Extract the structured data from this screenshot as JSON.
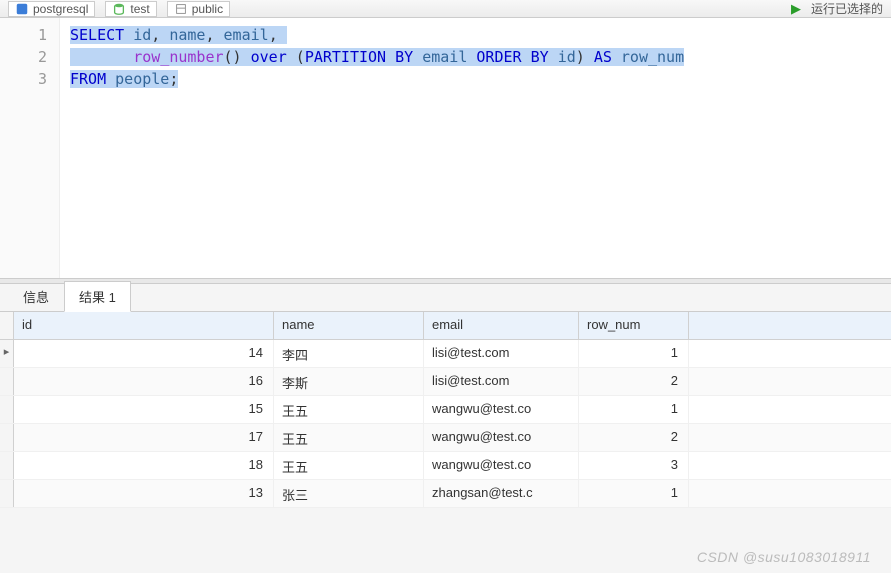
{
  "toolbar": {
    "connection_label": "postgresql",
    "database_label": "test",
    "schema_label": "public",
    "run_label": "运行已选择的"
  },
  "editor": {
    "lines": [
      "1",
      "2",
      "3"
    ],
    "code_tokens": [
      [
        {
          "t": "SELECT",
          "c": "kw",
          "hl": true
        },
        {
          "t": " ",
          "c": "plain",
          "hl": true
        },
        {
          "t": "id",
          "c": "ident",
          "hl": true
        },
        {
          "t": ", ",
          "c": "plain",
          "hl": true
        },
        {
          "t": "name",
          "c": "ident",
          "hl": true
        },
        {
          "t": ", ",
          "c": "plain",
          "hl": true
        },
        {
          "t": "email",
          "c": "ident",
          "hl": true
        },
        {
          "t": ", ",
          "c": "plain",
          "hl": true
        }
      ],
      [
        {
          "t": "       ",
          "c": "plain",
          "hl": true
        },
        {
          "t": "row_number",
          "c": "func",
          "hl": true
        },
        {
          "t": "() ",
          "c": "plain",
          "hl": true
        },
        {
          "t": "over",
          "c": "kw",
          "hl": true
        },
        {
          "t": " (",
          "c": "plain",
          "hl": true
        },
        {
          "t": "PARTITION BY",
          "c": "kw",
          "hl": true
        },
        {
          "t": " ",
          "c": "plain",
          "hl": true
        },
        {
          "t": "email",
          "c": "ident",
          "hl": true
        },
        {
          "t": " ",
          "c": "plain",
          "hl": true
        },
        {
          "t": "ORDER BY",
          "c": "kw",
          "hl": true
        },
        {
          "t": " ",
          "c": "plain",
          "hl": true
        },
        {
          "t": "id",
          "c": "ident",
          "hl": true
        },
        {
          "t": ") ",
          "c": "plain",
          "hl": true
        },
        {
          "t": "AS",
          "c": "kw",
          "hl": true
        },
        {
          "t": " ",
          "c": "plain",
          "hl": true
        },
        {
          "t": "row_num",
          "c": "ident",
          "hl": true
        }
      ],
      [
        {
          "t": "FROM",
          "c": "kw",
          "hl": true
        },
        {
          "t": " ",
          "c": "plain",
          "hl": true
        },
        {
          "t": "people",
          "c": "ident",
          "hl": true
        },
        {
          "t": ";",
          "c": "plain",
          "hl": true
        }
      ]
    ]
  },
  "tabs": {
    "info": "信息",
    "result": "结果 1"
  },
  "grid": {
    "columns": [
      "id",
      "name",
      "email",
      "row_num"
    ],
    "rows": [
      {
        "marker": "▸",
        "id": "14",
        "name": "李四",
        "email": "lisi@test.com",
        "row_num": "1"
      },
      {
        "marker": "",
        "id": "16",
        "name": "李斯",
        "email": "lisi@test.com",
        "row_num": "2"
      },
      {
        "marker": "",
        "id": "15",
        "name": "王五",
        "email": "wangwu@test.co",
        "row_num": "1"
      },
      {
        "marker": "",
        "id": "17",
        "name": "王五",
        "email": "wangwu@test.co",
        "row_num": "2"
      },
      {
        "marker": "",
        "id": "18",
        "name": "王五",
        "email": "wangwu@test.co",
        "row_num": "3"
      },
      {
        "marker": "",
        "id": "13",
        "name": "张三",
        "email": "zhangsan@test.c",
        "row_num": "1"
      }
    ]
  },
  "watermark": "CSDN @susu1083018911"
}
